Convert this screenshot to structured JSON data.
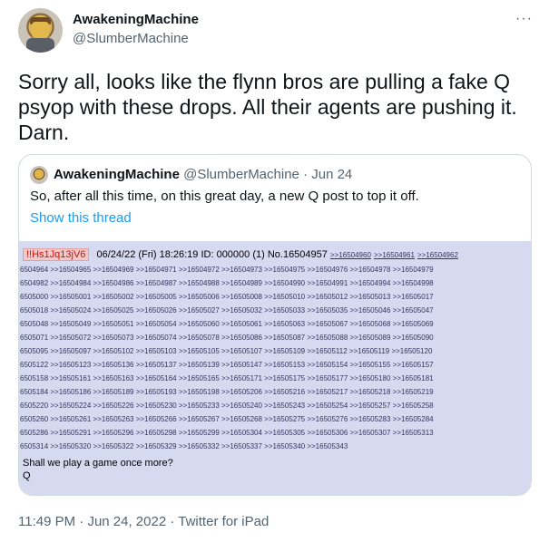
{
  "author": {
    "name": "AwakeningMachine",
    "handle": "@SlumberMachine"
  },
  "tweet": {
    "text": "Sorry all, looks like the flynn bros are pulling a fake Q psyop with these drops. All their agents are pushing it. Darn."
  },
  "quoted": {
    "name": "AwakeningMachine",
    "handle": "@SlumberMachine",
    "separator": "·",
    "date": "Jun 24",
    "text": "So, after all this time, on this great day, a new Q post to top it off.",
    "show_thread": "Show this thread"
  },
  "image": {
    "poster_id": "!!Hs1Jq13jV6",
    "header": "06/24/22 (Fri) 18:26:19 ID: 000000 (1) No.16504957",
    "head_refs": [
      ">>16504960",
      ">>16504961",
      ">>16504962"
    ],
    "ref_lines": [
      "6504964 >>16504965 >>16504969 >>16504971 >>16504972 >>16504973 >>16504975 >>16504976 >>16504978 >>16504979",
      "6504982 >>16504984 >>16504986 >>16504987 >>16504988 >>16504989 >>16504990 >>16504991 >>16504994 >>16504998",
      "6505000 >>16505001 >>16505002 >>16505005 >>16505006 >>16505008 >>16505010 >>16505012 >>16505013 >>16505017",
      "6505018 >>16505024 >>16505025 >>16505026 >>16505027 >>16505032 >>16505033 >>16505035 >>16505046 >>16505047",
      "6505048 >>16505049 >>16505051 >>16505054 >>16505060 >>16505061 >>16505063 >>16505067 >>16505068 >>16505069",
      "6505071 >>16505072 >>16505073 >>16505074 >>16505078 >>16505086 >>16505087 >>16505088 >>16505089 >>16505090",
      "6505095 >>16505097 >>16505102 >>16505103 >>16505105 >>16505107 >>16505109 >>16505112 >>16505119 >>16505120",
      "6505122 >>16505123 >>16505136 >>16505137 >>16505139 >>16505147 >>16505153 >>16505154 >>16505155 >>16505157",
      "6505158 >>16505161 >>16505163 >>16505164 >>16505165 >>16505171 >>16505175 >>16505177 >>16505180 >>16505181",
      "6505184 >>16505186 >>16505189 >>16505193 >>16505198 >>16505206 >>16505216 >>16505217 >>16505218 >>16505219",
      "6505220 >>16505224 >>16505226 >>16505230 >>16505233 >>16505240 >>16505243 >>16505254 >>16505257 >>16505258",
      "6505260 >>16505261 >>16505263 >>16505266 >>16505267 >>16505268 >>16505275 >>16505276 >>16505283 >>16505284",
      "6505286 >>16505291 >>16505296 >>16505298 >>16505299 >>16505304 >>16505305 >>16505306 >>16505307 >>16505313",
      "6505314 >>16505320 >>16505322 >>16505329 >>16505332 >>16505337 >>16505340 >>16505343"
    ],
    "body_line1": "Shall we play a game once more?",
    "body_line2": "Q"
  },
  "footer": {
    "time": "11:49 PM",
    "separator": "·",
    "date": "Jun 24, 2022",
    "source": "Twitter for iPad"
  },
  "icons": {
    "more": "more-horizontal-icon"
  }
}
